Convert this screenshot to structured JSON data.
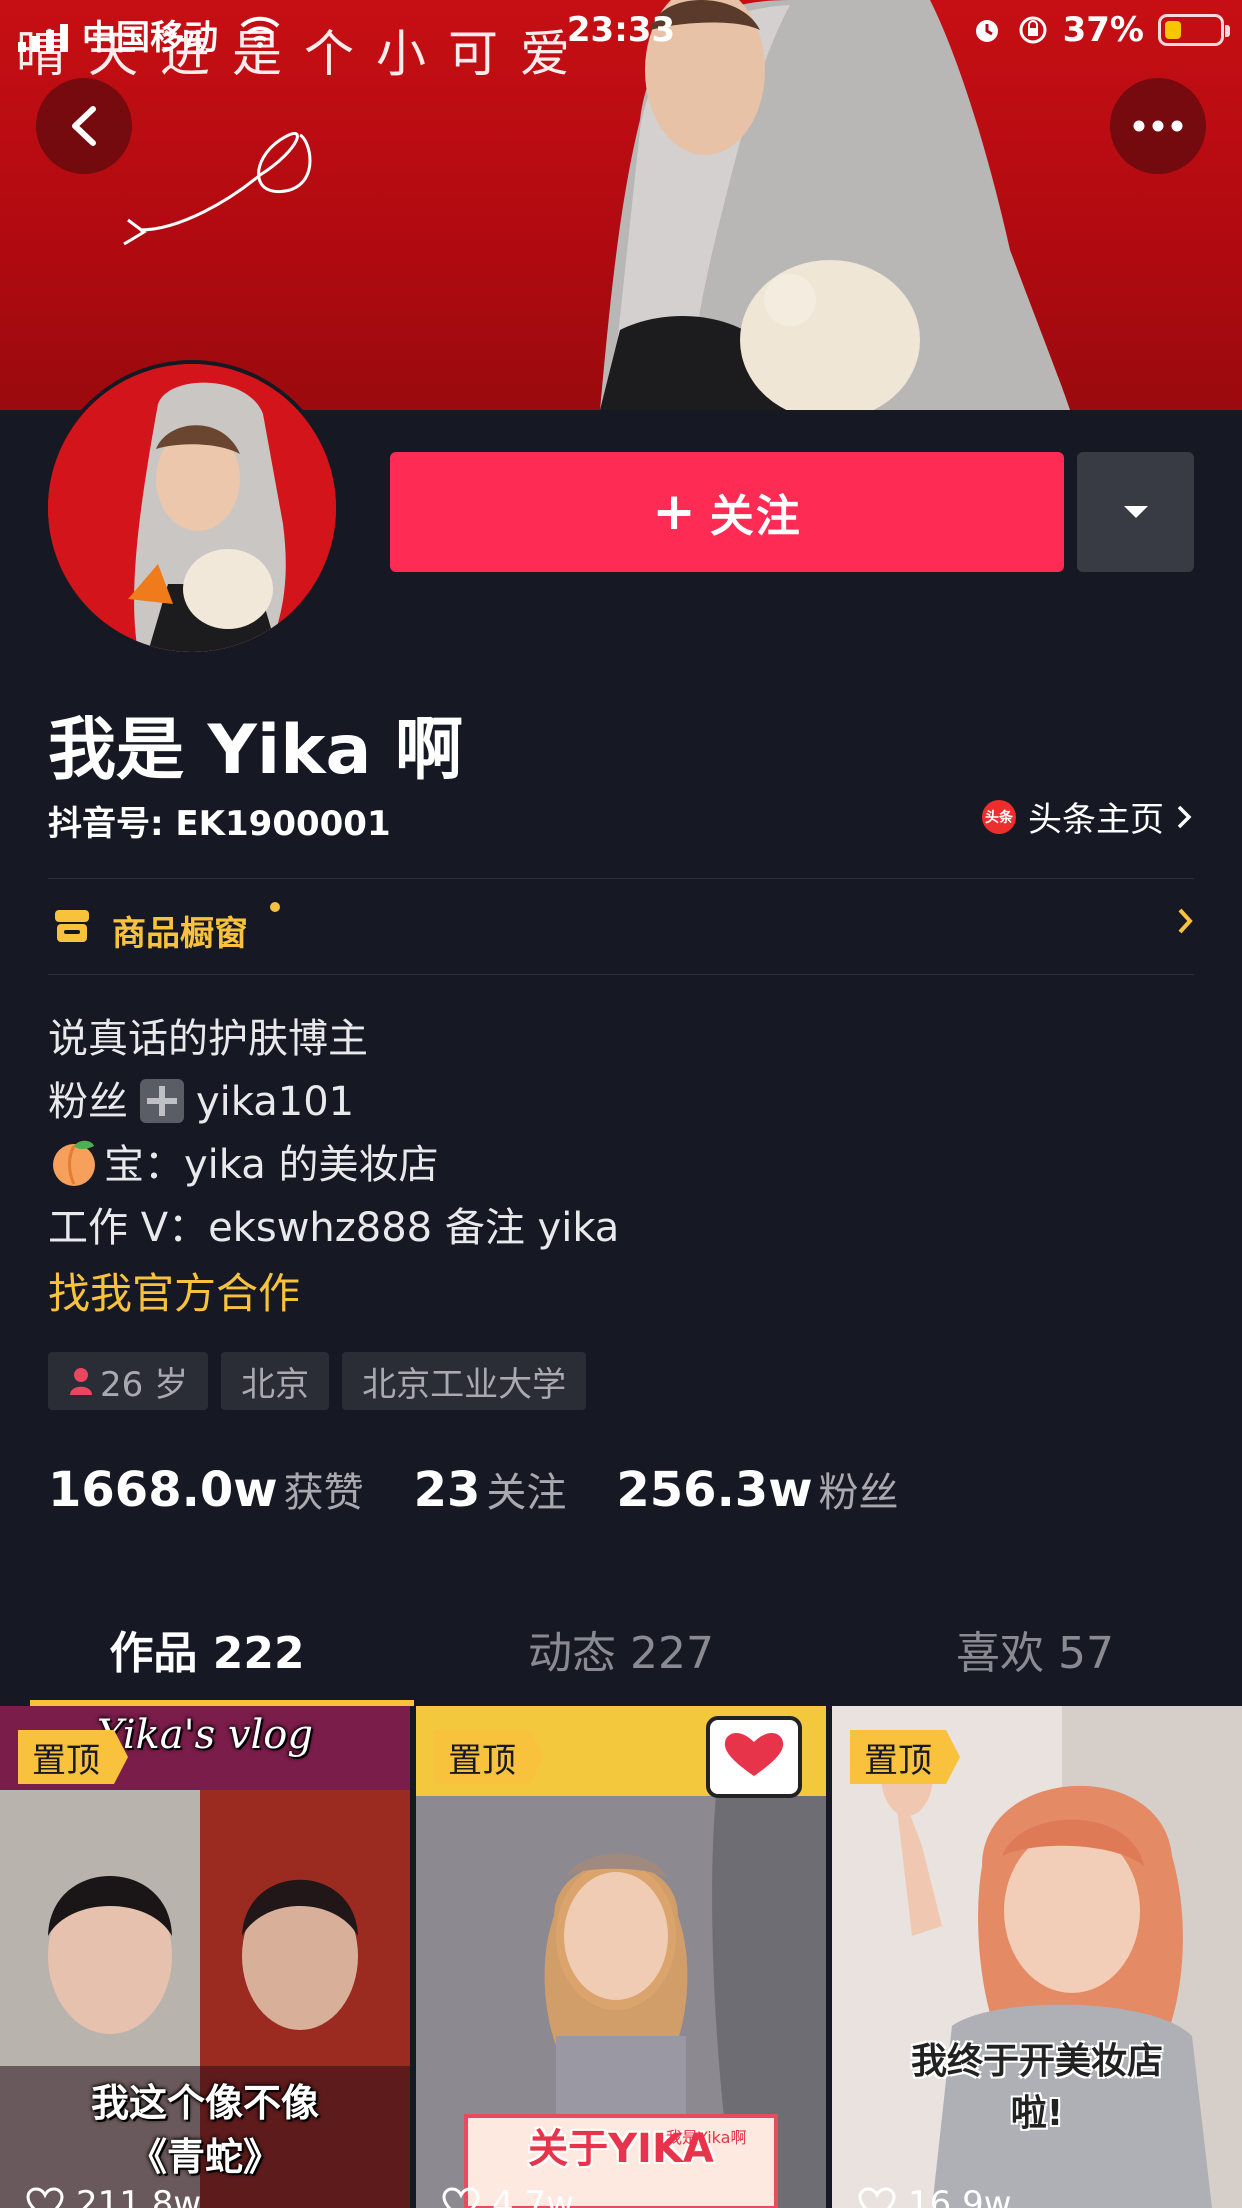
{
  "status_bar": {
    "carrier": "中国移动",
    "time": "23:33",
    "battery": "37%"
  },
  "cover": {
    "handwriting": "晴天进是个小可爱"
  },
  "profile": {
    "follow_label": "关注",
    "name": "我是 Yika 啊",
    "douyin_id": "抖音号: EK1900001",
    "toutiao_badge": "头条",
    "toutiao_label": "头条主页",
    "shop_label": "商品橱窗",
    "bio": {
      "line1": "说真话的护肤博主",
      "line2_pre": "粉丝",
      "line2_post": "yika101",
      "line3": "宝：yika 的美妆店",
      "line4": "工作 V：ekswhz888 备注 yika"
    },
    "coop_link": "找我官方合作",
    "tags": {
      "age": "26 岁",
      "city": "北京",
      "school": "北京工业大学"
    },
    "stats": {
      "likes_num": "1668.0w",
      "likes_label": "获赞",
      "following_num": "23",
      "following_label": "关注",
      "followers_num": "256.3w",
      "followers_label": "粉丝"
    }
  },
  "tabs": {
    "works": "作品 222",
    "dynamics": "动态 227",
    "likes": "喜欢 57",
    "active": "works"
  },
  "videos": [
    {
      "pin": "置顶",
      "title": "Yika's vlog",
      "caption1": "我这个像不像",
      "caption2": "《青蛇》",
      "likes": "211.8w"
    },
    {
      "pin": "置顶",
      "caption1": "关于YIKA",
      "caption_tag": "我是Yika啊",
      "likes": "4.7w"
    },
    {
      "pin": "置顶",
      "caption1": "我终于开美妆店",
      "caption2": "啦!",
      "likes": "16.9w"
    }
  ],
  "colors": {
    "background": "#161823",
    "follow": "#fe2c55",
    "accent_yellow": "#f8c23d",
    "muted_text": "#a9aab0"
  }
}
